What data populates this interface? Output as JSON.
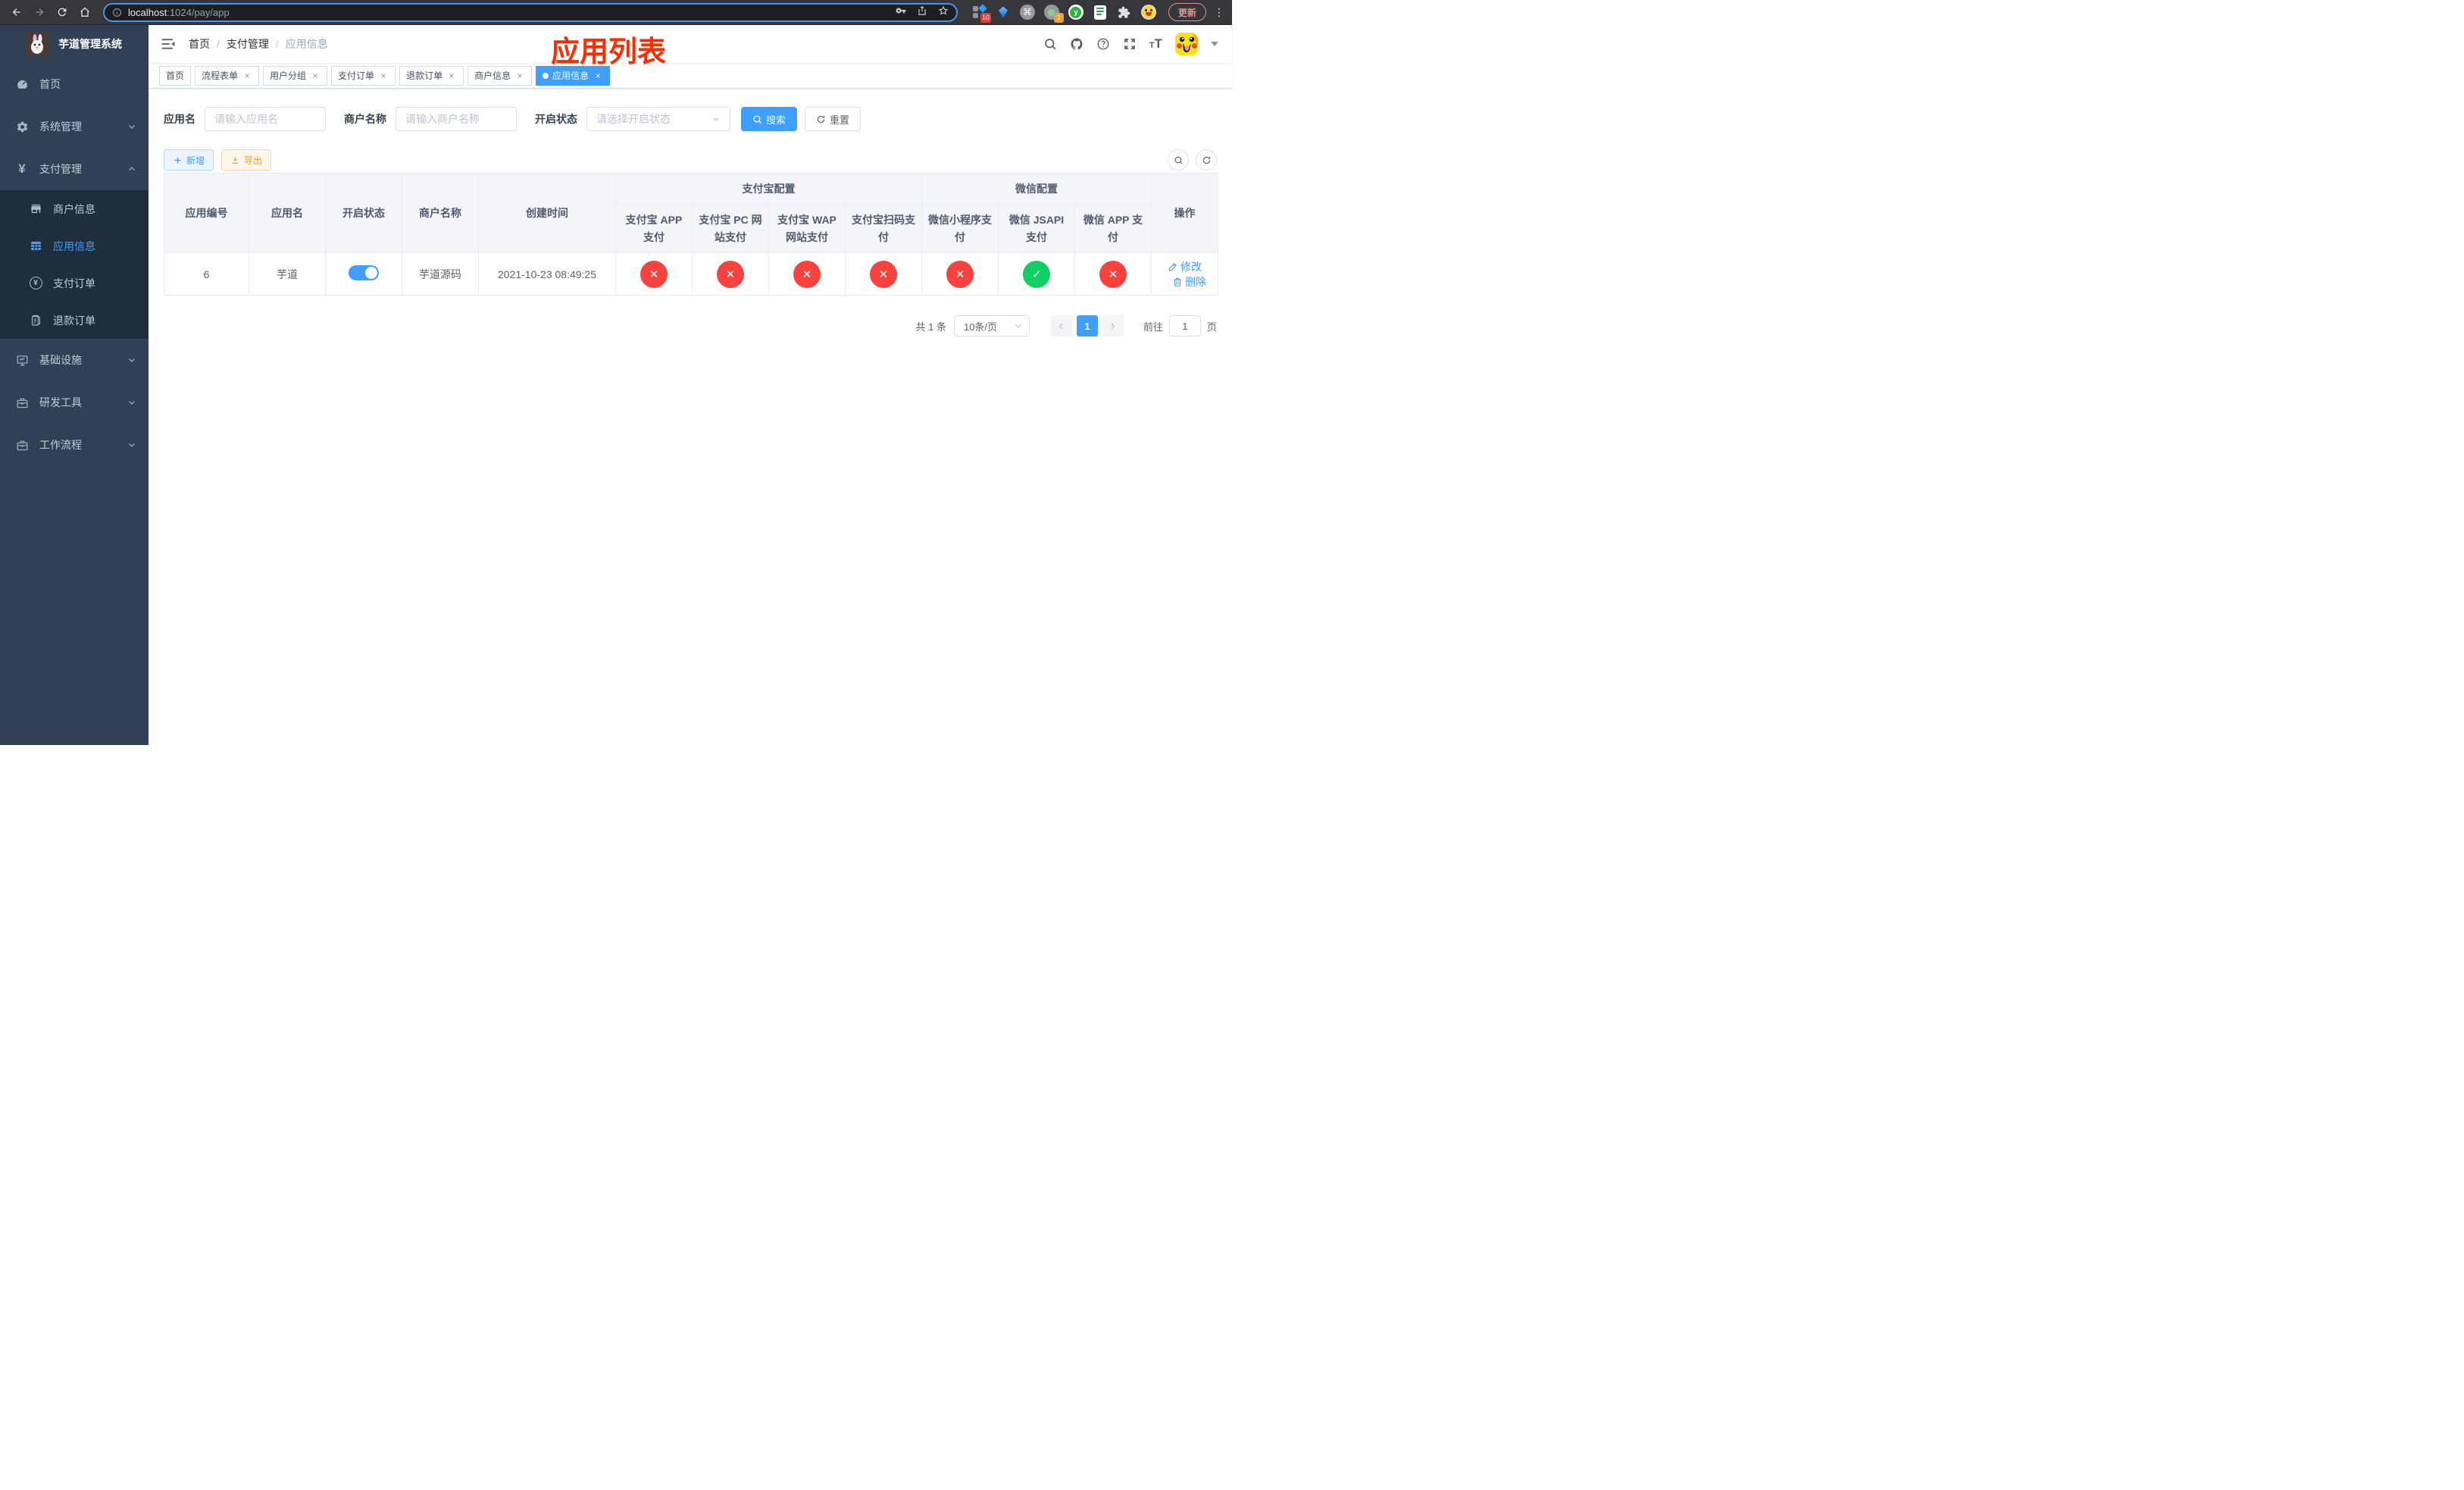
{
  "colors": {
    "accent": "#409eff",
    "danger": "#f9413d",
    "success": "#13ce66",
    "warning": "#e6a23c",
    "annotation_red": "#fe2c00",
    "sidebar_bg": "#304156",
    "submenu_bg": "#1f2d3d"
  },
  "browser": {
    "url_host": "localhost",
    "url_path": ":1024/pay/app",
    "update_label": "更新",
    "ext_badge_1": "10",
    "ext_badge_2": "1",
    "ext_y_label": "y"
  },
  "sidebar": {
    "title": "芋道管理系统",
    "menu": [
      {
        "label": "首页",
        "icon": "gauge-icon"
      },
      {
        "label": "系统管理",
        "icon": "gear-icon",
        "expandable": true
      },
      {
        "label": "支付管理",
        "icon": "yen-icon",
        "expandable": true,
        "expanded": true
      }
    ],
    "submenu": [
      {
        "label": "商户信息",
        "icon": "store-icon"
      },
      {
        "label": "应用信息",
        "icon": "grid-icon",
        "active": true
      },
      {
        "label": "支付订单",
        "icon": "yen-circle-icon"
      },
      {
        "label": "退款订单",
        "icon": "document-icon"
      }
    ],
    "menu_bottom": [
      {
        "label": "基础设施",
        "icon": "monitor-icon",
        "expandable": true
      },
      {
        "label": "研发工具",
        "icon": "briefcase-icon",
        "expandable": true
      },
      {
        "label": "工作流程",
        "icon": "briefcase-icon",
        "expandable": true
      }
    ]
  },
  "navbar": {
    "breadcrumb": [
      "首页",
      "支付管理",
      "应用信息"
    ]
  },
  "annotation": "应用列表",
  "tabs": [
    {
      "label": "首页",
      "closable": false
    },
    {
      "label": "流程表单",
      "closable": true
    },
    {
      "label": "用户分组",
      "closable": true
    },
    {
      "label": "支付订单",
      "closable": true
    },
    {
      "label": "退款订单",
      "closable": true
    },
    {
      "label": "商户信息",
      "closable": true
    },
    {
      "label": "应用信息",
      "closable": true,
      "active": true
    }
  ],
  "search": {
    "fields": [
      {
        "label": "应用名",
        "placeholder": "请输入应用名",
        "value": ""
      },
      {
        "label": "商户名称",
        "placeholder": "请输入商户名称",
        "value": ""
      },
      {
        "label": "开启状态",
        "placeholder": "请选择开启状态",
        "value": ""
      }
    ],
    "search_label": "搜索",
    "reset_label": "重置"
  },
  "toolbar": {
    "add_label": "新增",
    "export_label": "导出"
  },
  "table": {
    "headers": {
      "app_id": "应用编号",
      "app_name": "应用名",
      "status": "开启状态",
      "merchant": "商户名称",
      "created": "创建时间",
      "alipay_group": "支付宝配置",
      "wechat_group": "微信配置",
      "actions": "操作",
      "pay_columns": [
        "支付宝 APP 支付",
        "支付宝 PC 网站支付",
        "支付宝 WAP 网站支付",
        "支付宝扫码支付",
        "微信小程序支付",
        "微信 JSAPI 支付",
        "微信 APP 支付"
      ]
    },
    "row": {
      "app_id": "6",
      "app_name": "芋道",
      "enabled": true,
      "merchant": "芋道源码",
      "created": "2021-10-23 08:49:25",
      "statuses": [
        {
          "name": "alipay-app-pay",
          "state": "fail"
        },
        {
          "name": "alipay-pc-pay",
          "state": "fail"
        },
        {
          "name": "alipay-wap-pay",
          "state": "fail"
        },
        {
          "name": "alipay-qr-pay",
          "state": "fail"
        },
        {
          "name": "wechat-lite-pay",
          "state": "fail"
        },
        {
          "name": "wechat-jsapi-pay",
          "state": "success"
        },
        {
          "name": "wechat-app-pay",
          "state": "fail"
        }
      ],
      "edit_label": "修改",
      "delete_label": "删除"
    }
  },
  "pagination": {
    "total": "共 1 条",
    "page_size": "10条/页",
    "current_page": "1",
    "goto_label": "前往",
    "goto_value": "1",
    "page_unit": "页"
  }
}
